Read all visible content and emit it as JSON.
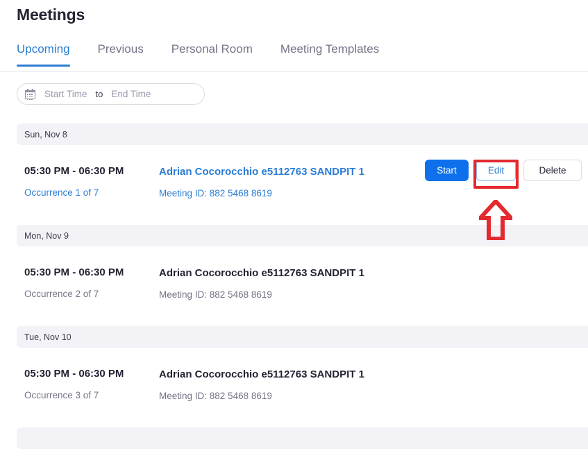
{
  "page": {
    "title": "Meetings"
  },
  "tabs": [
    {
      "label": "Upcoming",
      "active": true
    },
    {
      "label": "Previous",
      "active": false
    },
    {
      "label": "Personal Room",
      "active": false
    },
    {
      "label": "Meeting Templates",
      "active": false
    }
  ],
  "filter": {
    "icon": "calendar-icon",
    "start_placeholder": "Start Time",
    "separator": "to",
    "end_placeholder": "End Time",
    "start_value": "",
    "end_value": ""
  },
  "actions": {
    "start_label": "Start",
    "edit_label": "Edit",
    "delete_label": "Delete"
  },
  "groups": [
    {
      "date": "Sun, Nov 8",
      "meeting": {
        "time": "05:30 PM - 06:30 PM",
        "occurrence": "Occurrence 1 of 7",
        "title": "Adrian Cocorocchio e5112763 SANDPIT 1",
        "meeting_id": "Meeting ID: 882 5468 8619",
        "highlighted": true
      }
    },
    {
      "date": "Mon, Nov 9",
      "meeting": {
        "time": "05:30 PM - 06:30 PM",
        "occurrence": "Occurrence 2 of 7",
        "title": "Adrian Cocorocchio e5112763 SANDPIT 1",
        "meeting_id": "Meeting ID: 882 5468 8619",
        "highlighted": false
      }
    },
    {
      "date": "Tue, Nov 10",
      "meeting": {
        "time": "05:30 PM - 06:30 PM",
        "occurrence": "Occurrence 3 of 7",
        "title": "Adrian Cocorocchio e5112763 SANDPIT 1",
        "meeting_id": "Meeting ID: 882 5468 8619",
        "highlighted": false
      }
    }
  ],
  "annotation": {
    "target": "Edit",
    "box_color": "#e22a2f",
    "arrow_color": "#e22a2f"
  },
  "colors": {
    "accent_blue": "#2b7cd3",
    "start_blue": "#0e71eb",
    "band_gray": "#f2f2f7",
    "muted_text": "#747487"
  }
}
